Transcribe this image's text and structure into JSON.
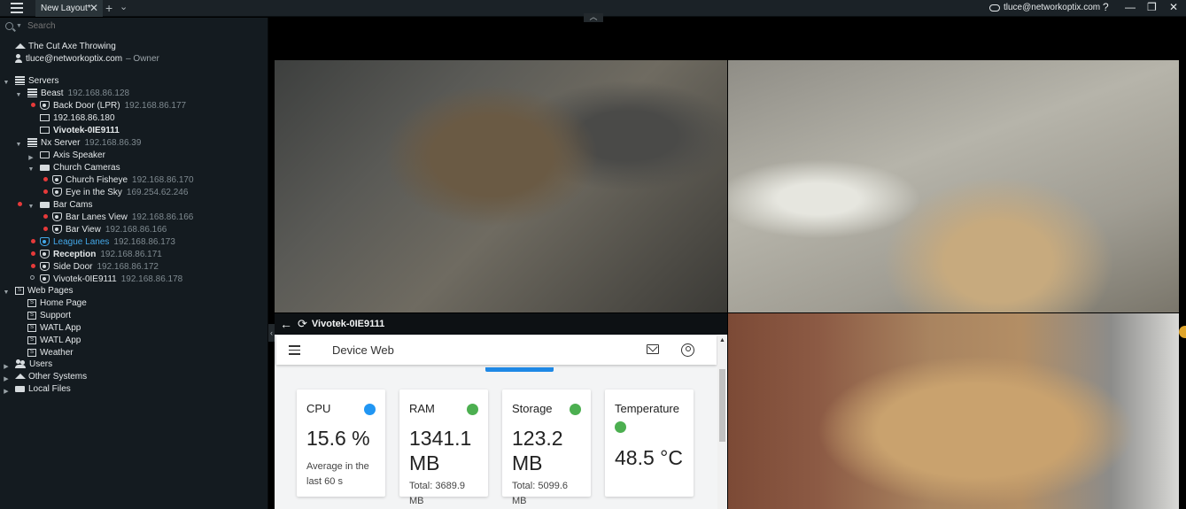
{
  "titlebar": {
    "tab_label": "New Layout*",
    "tab_close": "✕",
    "add_tab": "+",
    "tab_menu": "⌄",
    "user": "tluce@networkoptix.com",
    "help": "?",
    "minimize": "—",
    "restore": "❐",
    "close": "✕"
  },
  "search": {
    "placeholder": "Search"
  },
  "tree": {
    "system": "The Cut Axe Throwing",
    "user": "tluce@networkoptix.com",
    "user_role": "– Owner",
    "servers": "Servers",
    "beast": {
      "name": "Beast",
      "ip": "192.168.86.128"
    },
    "back_door": {
      "name": "Back Door (LPR)",
      "ip": "192.168.86.177"
    },
    "ip_180": {
      "name": "192.168.86.180"
    },
    "vivotek_a": {
      "name": "Vivotek-0IE9111"
    },
    "nx_server": {
      "name": "Nx Server",
      "ip": "192.168.86.39"
    },
    "axis_speaker": {
      "name": "Axis Speaker"
    },
    "church_cameras": {
      "name": "Church Cameras"
    },
    "church_fisheye": {
      "name": "Church Fisheye",
      "ip": "192.168.86.170"
    },
    "eye_sky": {
      "name": "Eye in the Sky",
      "ip": "169.254.62.246"
    },
    "bar_cams": {
      "name": "Bar Cams"
    },
    "bar_lanes": {
      "name": "Bar Lanes View",
      "ip": "192.168.86.166"
    },
    "bar_view": {
      "name": "Bar View",
      "ip": "192.168.86.166"
    },
    "league_lanes": {
      "name": "League Lanes",
      "ip": "192.168.86.173"
    },
    "reception": {
      "name": "Reception",
      "ip": "192.168.86.171"
    },
    "side_door": {
      "name": "Side Door",
      "ip": "192.168.86.172"
    },
    "vivotek_b": {
      "name": "Vivotek-0IE9111",
      "ip": "192.168.86.178"
    },
    "web_pages": "Web Pages",
    "home_page": "Home Page",
    "support": "Support",
    "watl_app_1": "WATL App",
    "watl_app_2": "WATL App",
    "weather": "Weather",
    "users": "Users",
    "other_systems": "Other Systems",
    "local_files": "Local Files"
  },
  "webitem": {
    "back": "←",
    "refresh": "⟳",
    "title": "Vivotek-0IE9111",
    "app_title": "Device Web",
    "scroll_up": "▲",
    "cards": [
      {
        "title": "CPU",
        "value": "15.6 %",
        "sub": "Average in the last 60 s",
        "status_color": "#2196f3"
      },
      {
        "title": "RAM",
        "value": "1341.1 MB",
        "sub": "Total: 3689.9 MB",
        "status_color": "#4caf50"
      },
      {
        "title": "Storage",
        "value": "123.2 MB",
        "sub": "Total: 5099.6 MB",
        "status_color": "#4caf50"
      },
      {
        "title": "Temperature",
        "value": "48.5 °C",
        "status_color": "#4caf50"
      }
    ]
  },
  "layout": {
    "collapse_top": "︿",
    "left_handle": "‹"
  },
  "colors": {
    "accent": "#44a8e8",
    "offline": "#e63a3a",
    "panel": "#141b20"
  }
}
